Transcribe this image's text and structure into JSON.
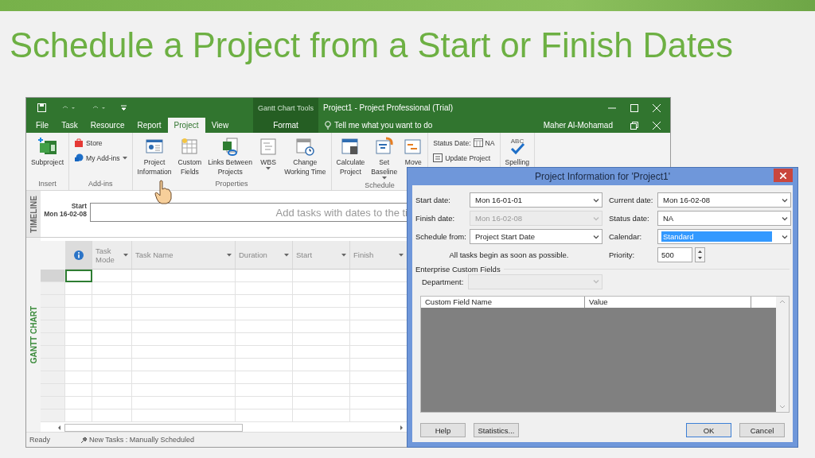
{
  "slide": {
    "title": "Schedule a Project from a Start or Finish Dates"
  },
  "app": {
    "contextual_group": "Gantt Chart Tools",
    "window_title": "Project1 - Project Professional (Trial)",
    "tabs": [
      {
        "label": "File",
        "selected": false,
        "kind": "normal"
      },
      {
        "label": "Task",
        "selected": false,
        "kind": "normal"
      },
      {
        "label": "Resource",
        "selected": false,
        "kind": "normal"
      },
      {
        "label": "Report",
        "selected": false,
        "kind": "normal"
      },
      {
        "label": "Project",
        "selected": true,
        "kind": "normal"
      },
      {
        "label": "View",
        "selected": false,
        "kind": "normal"
      },
      {
        "label": "Format",
        "selected": false,
        "kind": "contextual"
      }
    ],
    "tell_me": "Tell me what you want to do",
    "user": "Maher Al-Mohamad",
    "ribbon_groups": [
      {
        "label": "Insert",
        "buttons": [
          {
            "kind": "large",
            "lines": [
              "Subproject"
            ]
          }
        ]
      },
      {
        "label": "Add-ins",
        "buttons": [
          {
            "kind": "small",
            "lines": [
              "Store"
            ]
          },
          {
            "kind": "small",
            "lines": [
              "My Add-ins"
            ],
            "dropdown": true
          }
        ]
      },
      {
        "label": "Properties",
        "buttons": [
          {
            "kind": "large",
            "lines": [
              "Project",
              "Information"
            ]
          },
          {
            "kind": "large",
            "lines": [
              "Custom",
              "Fields"
            ]
          },
          {
            "kind": "large",
            "lines": [
              "Links Between",
              "Projects"
            ]
          },
          {
            "kind": "large",
            "lines": [
              "WBS"
            ],
            "dropdown": true
          },
          {
            "kind": "large",
            "lines": [
              "Change",
              "Working Time"
            ]
          }
        ]
      },
      {
        "label": "Schedule",
        "buttons": [
          {
            "kind": "large",
            "lines": [
              "Calculate",
              "Project"
            ]
          },
          {
            "kind": "large",
            "lines": [
              "Set",
              "Baseline"
            ],
            "dropdown": true
          },
          {
            "kind": "large",
            "lines": [
              "Move"
            ]
          }
        ]
      },
      {
        "buttons": [
          {
            "kind": "field",
            "label": "Status Date:",
            "value": "NA"
          },
          {
            "kind": "small",
            "lines": [
              "Update Project"
            ]
          }
        ]
      },
      {
        "buttons": [
          {
            "kind": "large",
            "lines": [
              "Spelling"
            ],
            "icon_text": "ABC"
          }
        ]
      }
    ],
    "timeline": {
      "label": "TIMELINE",
      "start_label": "Start",
      "start_date": "Mon 16-02-08",
      "hint": "Add tasks with dates to the ti"
    },
    "gantt": {
      "label": "GANTT CHART",
      "columns": [
        {
          "label": "Task Mode"
        },
        {
          "label": "Task Name"
        },
        {
          "label": "Duration"
        },
        {
          "label": "Start"
        },
        {
          "label": "Finish"
        }
      ]
    },
    "status_bar": {
      "state": "Ready",
      "new_tasks": "New Tasks : Manually Scheduled"
    }
  },
  "dialog": {
    "title": "Project Information for 'Project1'",
    "fields": [
      {
        "kind": "combo",
        "label": "Start date:",
        "value": "Mon 16-01-01",
        "disabled": false,
        "highlighted": false
      },
      {
        "kind": "combo",
        "label": "Current date:",
        "value": "Mon 16-02-08",
        "disabled": false,
        "highlighted": false
      },
      {
        "kind": "combo",
        "label": "Finish date:",
        "value": "Mon 16-02-08",
        "disabled": true,
        "highlighted": false
      },
      {
        "kind": "combo",
        "label": "Status date:",
        "value": "NA",
        "disabled": false,
        "highlighted": false
      },
      {
        "kind": "combo",
        "label": "Schedule from:",
        "value": "Project Start Date",
        "disabled": false,
        "highlighted": false
      },
      {
        "kind": "combo",
        "label": "Calendar:",
        "value": "Standard",
        "disabled": false,
        "highlighted": true
      },
      {
        "kind": "note",
        "text": "All tasks begin as soon as possible."
      },
      {
        "kind": "spin",
        "label": "Priority:",
        "value": "500"
      }
    ],
    "enterprise": {
      "label": "Enterprise Custom Fields",
      "department": {
        "label": "Department:",
        "disabled": true
      },
      "columns": [
        "Custom Field Name",
        "Value"
      ]
    },
    "buttons_left": [
      {
        "label": "Help",
        "default": false
      },
      {
        "label": "Statistics...",
        "default": false
      }
    ],
    "buttons_right": [
      {
        "label": "OK",
        "default": true
      },
      {
        "label": "Cancel",
        "default": false
      }
    ]
  }
}
